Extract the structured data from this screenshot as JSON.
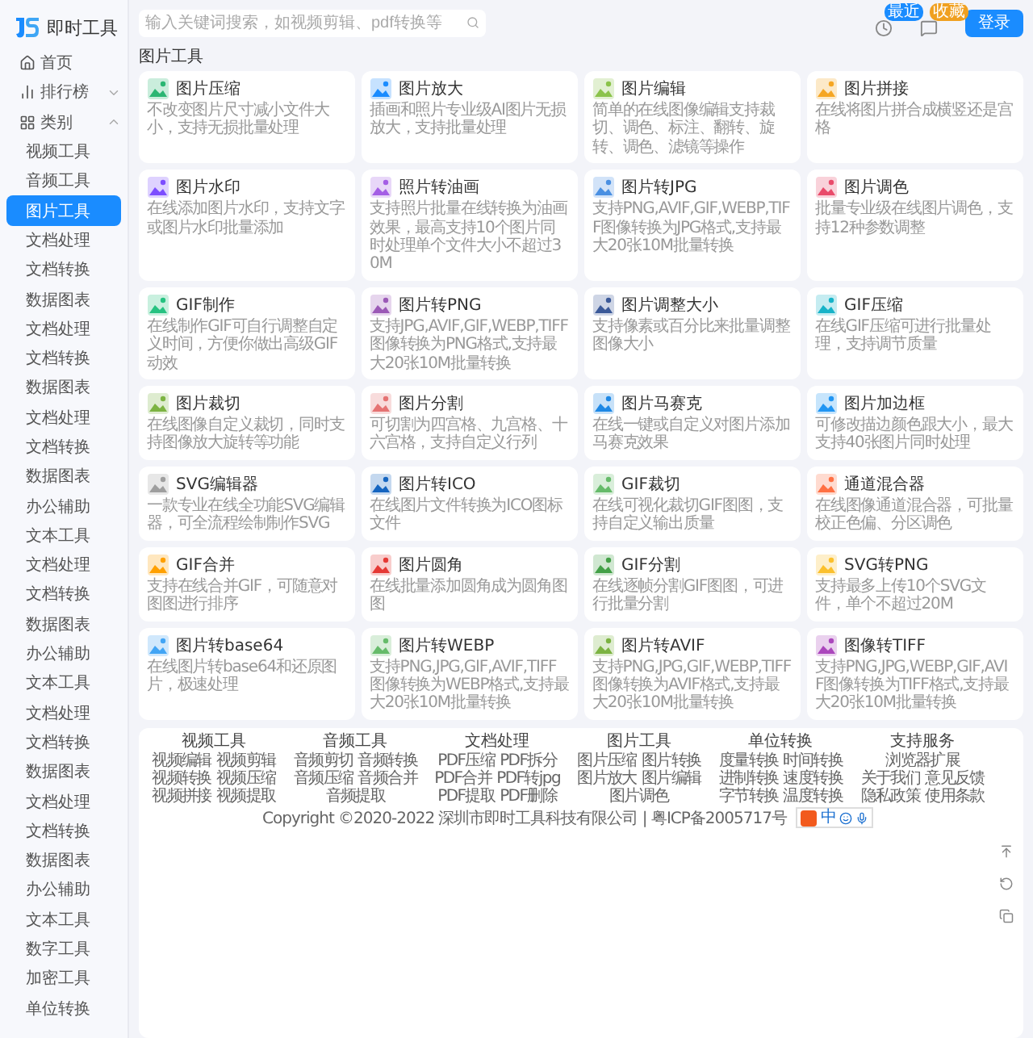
{
  "logo": {
    "text": "即时工具"
  },
  "search": {
    "placeholder": "输入关键词搜索，如视频剪辑、pdf转换等"
  },
  "header_actions": [
    {
      "kind": "history",
      "badge": "最近"
    },
    {
      "kind": "favorite",
      "badge": "收藏"
    }
  ],
  "login_button": "登录",
  "sidebar": {
    "items": [
      {
        "kind": "home",
        "label": "首页",
        "selected": false
      },
      {
        "kind": "ranking",
        "label": "排行榜",
        "selected": false,
        "expanded": false
      },
      {
        "kind": "category",
        "label": "类别",
        "selected": false,
        "expanded": true,
        "children": [
          {
            "label": "视频工具",
            "selected": false
          },
          {
            "label": "音频工具",
            "selected": false
          },
          {
            "label": "图片工具",
            "selected": true
          },
          {
            "label": "文档处理",
            "selected": false
          },
          {
            "label": "文档转换",
            "selected": false
          },
          {
            "label": "数据图表",
            "selected": false
          },
          {
            "label": "文档处理",
            "selected": false
          },
          {
            "label": "文档转换",
            "selected": false
          },
          {
            "label": "数据图表",
            "selected": false
          },
          {
            "label": "文档处理",
            "selected": false
          },
          {
            "label": "文档转换",
            "selected": false
          },
          {
            "label": "数据图表",
            "selected": false
          },
          {
            "label": "办公辅助",
            "selected": false
          },
          {
            "label": "文本工具",
            "selected": false
          },
          {
            "label": "文档处理",
            "selected": false
          },
          {
            "label": "文档转换",
            "selected": false
          },
          {
            "label": "数据图表",
            "selected": false
          },
          {
            "label": "办公辅助",
            "selected": false
          },
          {
            "label": "文本工具",
            "selected": false
          },
          {
            "label": "文档处理",
            "selected": false
          },
          {
            "label": "文档转换",
            "selected": false
          },
          {
            "label": "数据图表",
            "selected": false
          },
          {
            "label": "文档处理",
            "selected": false
          },
          {
            "label": "文档转换",
            "selected": false
          },
          {
            "label": "数据图表",
            "selected": false
          },
          {
            "label": "办公辅助",
            "selected": false
          },
          {
            "label": "文本工具",
            "selected": false
          },
          {
            "label": "数字工具",
            "selected": false
          },
          {
            "label": "加密工具",
            "selected": false
          },
          {
            "label": "单位转换",
            "selected": false
          }
        ]
      }
    ]
  },
  "page_title": "图片工具",
  "tools": [
    {
      "title": "图片压缩",
      "description": "不改变图片尺寸减小文件大小，支持无损批量处理"
    },
    {
      "title": "图片放大",
      "description": "插画和照片专业级AI图片无损放大，支持批量处理"
    },
    {
      "title": "图片编辑",
      "description": "简单的在线图像编辑支持裁切、调色、标注、翻转、旋转、调色、滤镜等操作"
    },
    {
      "title": "图片拼接",
      "description": "在线将图片拼合成横竖还是宫格"
    },
    {
      "title": "图片水印",
      "description": "在线添加图片水印，支持文字或图片水印批量添加"
    },
    {
      "title": "照片转油画",
      "description": "支持照片批量在线转换为油画效果，最高支持10个图片同时处理单个文件大小不超过30M"
    },
    {
      "title": "图片转JPG",
      "description": "支持PNG,AVIF,GIF,WEBP,TIFF图像转换为JPG格式,支持最大20张10M批量转换"
    },
    {
      "title": "图片调色",
      "description": "批量专业级在线图片调色，支持12种参数调整"
    },
    {
      "title": "GIF制作",
      "description": "在线制作GIF可自行调整自定义时间，方便你做出高级GIF动效"
    },
    {
      "title": "图片转PNG",
      "description": "支持JPG,AVIF,GIF,WEBP,TIFF图像转换为PNG格式,支持最大20张10M批量转换"
    },
    {
      "title": "图片调整大小",
      "description": "支持像素或百分比来批量调整图像大小"
    },
    {
      "title": "GIF压缩",
      "description": "在线GIF压缩可进行批量处理，支持调节质量"
    },
    {
      "title": "图片裁切",
      "description": "在线图像自定义裁切，同时支持图像放大旋转等功能"
    },
    {
      "title": "图片分割",
      "description": "可切割为四宫格、九宫格、十六宫格，支持自定义行列"
    },
    {
      "title": "图片马赛克",
      "description": "在线一键或自定义对图片添加马赛克效果"
    },
    {
      "title": "图片加边框",
      "description": "可修改描边颜色跟大小，最大支持40张图片同时处理"
    },
    {
      "title": "SVG编辑器",
      "description": "一款专业在线全功能SVG编辑器，可全流程绘制制作SVG"
    },
    {
      "title": "图片转ICO",
      "description": "在线图片文件转换为ICO图标文件"
    },
    {
      "title": "GIF裁切",
      "description": "在线可视化裁切GIF图图，支持自定义输出质量"
    },
    {
      "title": "通道混合器",
      "description": "在线图像通道混合器，可批量校正色偏、分区调色"
    },
    {
      "title": "GIF合并",
      "description": "支持在线合并GIF，可随意对图图进行排序"
    },
    {
      "title": "图片圆角",
      "description": "在线批量添加圆角成为圆角图图"
    },
    {
      "title": "GIF分割",
      "description": "在线逐帧分割GIF图图，可进行批量分割"
    },
    {
      "title": "SVG转PNG",
      "description": "支持最多上传10个SVG文件，单个不超过20M"
    },
    {
      "title": "图片转base64",
      "description": "在线图片转base64和还原图片，极速处理"
    },
    {
      "title": "图片转WEBP",
      "description": "支持PNG,JPG,GIF,AVIF,TIFF图像转换为WEBP格式,支持最大20张10M批量转换"
    },
    {
      "title": "图片转AVIF",
      "description": "支持PNG,JPG,GIF,WEBP,TIFF图像转换为AVIF格式,支持最大20张10M批量转换"
    },
    {
      "title": "图像转TIFF",
      "description": "支持PNG,JPG,WEBP,GIF,AVIF图像转换为TIFF格式,支持最大20张10M批量转换"
    }
  ],
  "footer": {
    "columns": [
      {
        "heading": "视频工具",
        "links": [
          "视频编辑",
          "视频剪辑",
          "视频转换",
          "视频压缩",
          "视频拼接",
          "视频提取"
        ]
      },
      {
        "heading": "音频工具",
        "links": [
          "音频剪切",
          "音频转换",
          "音频压缩",
          "音频合并",
          "音频提取"
        ]
      },
      {
        "heading": "文档处理",
        "links": [
          "PDF压缩",
          "PDF拆分",
          "PDF合并",
          "PDF转jpg",
          "PDF提取",
          "PDF删除"
        ]
      },
      {
        "heading": "图片工具",
        "links": [
          "图片压缩",
          "图片转换",
          "图片放大",
          "图片编辑",
          "图片调色"
        ]
      },
      {
        "heading": "单位转换",
        "links": [
          "度量转换",
          "时间转换",
          "进制转换",
          "速度转换",
          "字节转换",
          "温度转换"
        ]
      },
      {
        "heading": "支持服务",
        "links": [
          "浏览器扩展",
          "关于我们",
          "意见反馈",
          "隐私政策",
          "使用条款"
        ]
      }
    ],
    "copyright": "Copyright ©2020-2022 深圳市即时工具科技有限公司 | 粤ICP备2005717号"
  },
  "ime_toolbar": {
    "label": "中"
  }
}
